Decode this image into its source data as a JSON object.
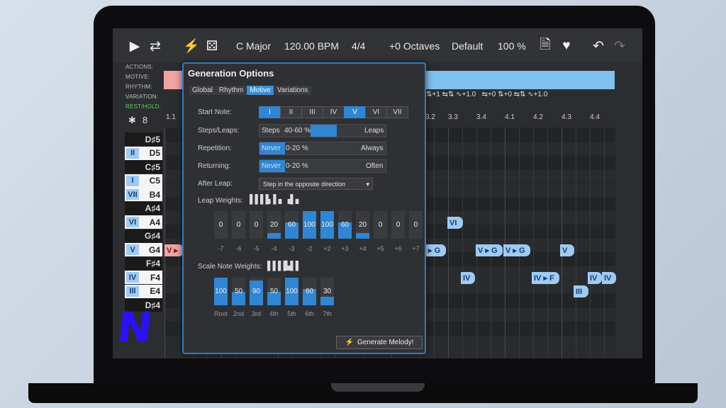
{
  "toolbar": {
    "key": "C Major",
    "tempo": "120.00 BPM",
    "time_sig": "4/4",
    "octaves": "+0 Octaves",
    "preset": "Default",
    "zoom": "100 %"
  },
  "row_labels": {
    "actions": "ACTIONS:",
    "motive": "MOTIVE:",
    "rhythm": "RHYTHM:",
    "variation": "VARIATION:",
    "rest_hold": "REST/HOLD:"
  },
  "ruler": [
    "1.1",
    "3.2",
    "3.3",
    "3.4",
    "4.1",
    "4.2",
    "4.3",
    "4.4"
  ],
  "keys": [
    {
      "note": "D♯5",
      "type": "b",
      "deg": ""
    },
    {
      "note": "D5",
      "type": "w",
      "deg": "II"
    },
    {
      "note": "C♯5",
      "type": "b",
      "deg": ""
    },
    {
      "note": "C5",
      "type": "w",
      "deg": "I"
    },
    {
      "note": "B4",
      "type": "w",
      "deg": "VII"
    },
    {
      "note": "A♯4",
      "type": "b",
      "deg": ""
    },
    {
      "note": "A4",
      "type": "w",
      "deg": "VI"
    },
    {
      "note": "G♯4",
      "type": "b",
      "deg": ""
    },
    {
      "note": "G4",
      "type": "w",
      "deg": "V"
    },
    {
      "note": "F♯4",
      "type": "b",
      "deg": ""
    },
    {
      "note": "F4",
      "type": "w",
      "deg": "IV"
    },
    {
      "note": "E4",
      "type": "w",
      "deg": "III"
    },
    {
      "note": "D♯4",
      "type": "b",
      "deg": ""
    }
  ],
  "notes": {
    "v_start": "V ▸",
    "vi": "VI",
    "v_g1": "▸ G",
    "v_g2": "V ▸ G",
    "v_g3": "V ▸ G",
    "v": "V",
    "iv1": "IV",
    "iv_f": "IV ▸ F",
    "iv2": "IV",
    "iv3": "IV",
    "iii": "III"
  },
  "panel": {
    "title": "Generation Options",
    "tabs": [
      "Global",
      "Rhythm",
      "Motive",
      "Variations"
    ],
    "start_note": {
      "label": "Start Note:",
      "options": [
        "I",
        "II",
        "III",
        "IV",
        "V",
        "VI",
        "VII"
      ]
    },
    "steps": {
      "label": "Steps/Leaps:",
      "left": "Steps",
      "value": "40-60 %",
      "right": "Leaps"
    },
    "repetition": {
      "label": "Repetition:",
      "left": "Never",
      "value": "0-20 %",
      "right": "Always"
    },
    "returning": {
      "label": "Returning:",
      "left": "Never",
      "value": "0-20 %",
      "right": "Often"
    },
    "after_leap": {
      "label": "After Leap:",
      "value": "Step in the opposite direction"
    },
    "leap_weights": {
      "label": "Leap Weights:",
      "values": [
        0,
        0,
        0,
        20,
        60,
        100,
        100,
        60,
        20,
        0,
        0,
        0
      ],
      "labels": [
        "-7",
        "-6",
        "-5",
        "-4",
        "-3",
        "-2",
        "+2",
        "+3",
        "+4",
        "+5",
        "+6",
        "+7"
      ]
    },
    "scale_weights": {
      "label": "Scale Note Weights:",
      "values": [
        100,
        50,
        90,
        50,
        100,
        60,
        30
      ],
      "labels": [
        "Root",
        "2nd",
        "3rd",
        "4th",
        "5th",
        "6th",
        "7th"
      ]
    },
    "generate": "Generate Melody!"
  },
  "logo_text": "N"
}
